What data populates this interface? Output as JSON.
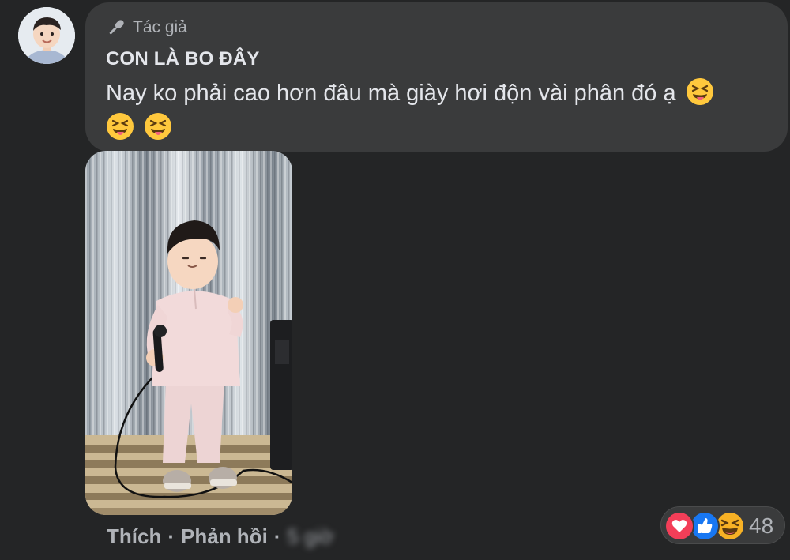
{
  "comment": {
    "badge_icon": "microphone-icon",
    "badge_label": "Tác giả",
    "author_name": "CON LÀ BO ĐÂY",
    "message_text": "Nay ko phải cao hơn đâu mà giày hơi độn vài phân đó ạ",
    "message_emojis": [
      "squinting-tongue-emoji",
      "squinting-tongue-emoji",
      "squinting-tongue-emoji"
    ]
  },
  "actions": {
    "like_label": "Thích",
    "separator": "·",
    "reply_label": "Phản hồi",
    "time_label": "5 giờ"
  },
  "reactions": {
    "types": [
      "love-icon",
      "like-icon",
      "haha-icon"
    ],
    "count": "48"
  },
  "colors": {
    "background": "#242526",
    "bubble": "#3a3b3c",
    "primary_text": "#e4e6eb",
    "secondary_text": "#b0b3b8",
    "love": "#f33e58",
    "like": "#1877f2",
    "haha": "#f7b125"
  }
}
